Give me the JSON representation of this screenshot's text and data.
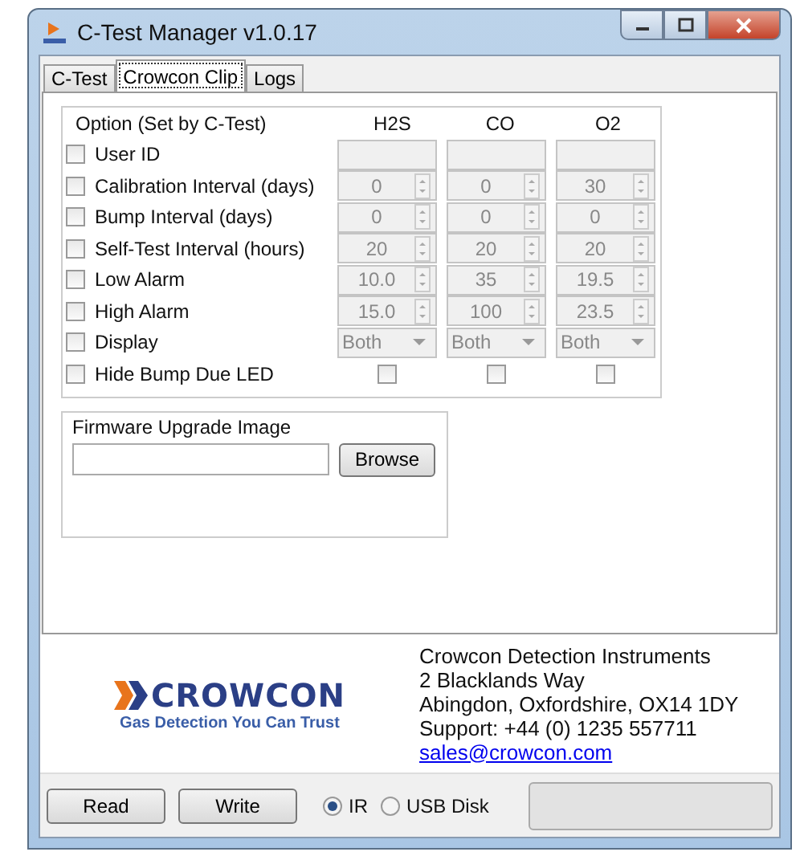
{
  "window": {
    "title": "C-Test Manager v1.0.17"
  },
  "tabs": [
    {
      "label": "C-Test",
      "selected": false
    },
    {
      "label": "Crowcon Clip",
      "selected": true
    },
    {
      "label": "Logs",
      "selected": false
    }
  ],
  "options": {
    "heading": "Option (Set by C-Test)",
    "columns": [
      "H2S",
      "CO",
      "O2"
    ],
    "rows": [
      {
        "kind": "text",
        "label": "User ID",
        "checked": false
      },
      {
        "kind": "spin",
        "label": "Calibration Interval (days)",
        "checked": false,
        "values": [
          "0",
          "0",
          "30"
        ]
      },
      {
        "kind": "spin",
        "label": "Bump Interval (days)",
        "checked": false,
        "values": [
          "0",
          "0",
          "0"
        ]
      },
      {
        "kind": "spin",
        "label": "Self-Test Interval (hours)",
        "checked": false,
        "values": [
          "20",
          "20",
          "20"
        ]
      },
      {
        "kind": "spin",
        "label": "Low Alarm",
        "checked": false,
        "values": [
          "10.0",
          "35",
          "19.5"
        ]
      },
      {
        "kind": "spin",
        "label": "High Alarm",
        "checked": false,
        "values": [
          "15.0",
          "100",
          "23.5"
        ]
      },
      {
        "kind": "dropdown",
        "label": "Display",
        "checked": false,
        "values": [
          "Both",
          "Both",
          "Both"
        ]
      },
      {
        "kind": "check",
        "label": "Hide Bump Due LED",
        "checked": false,
        "checks": [
          false,
          false,
          false
        ]
      }
    ]
  },
  "firmware": {
    "title": "Firmware Upgrade Image",
    "button": "Browse"
  },
  "company": {
    "logo": "CROWCON",
    "tagline": "Gas Detection You Can Trust",
    "lines": [
      "Crowcon Detection Instruments",
      "2 Blacklands Way",
      "Abingdon, Oxfordshire, OX14 1DY",
      "Support: +44 (0) 1235 557711"
    ],
    "email": "sales@crowcon.com"
  },
  "bottom": {
    "buttons": [
      "Read",
      "Write"
    ],
    "radios": [
      {
        "label": "IR",
        "selected": true
      },
      {
        "label": "USB Disk",
        "selected": false
      }
    ],
    "progress": {
      "level": 0
    }
  }
}
